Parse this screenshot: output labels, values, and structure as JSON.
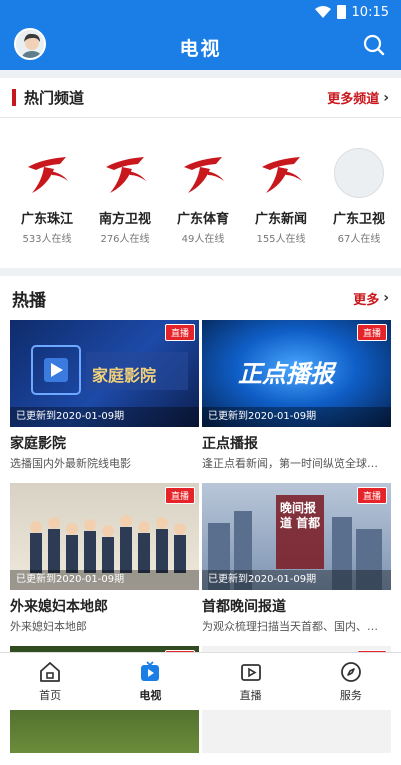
{
  "status": {
    "time": "10:15"
  },
  "header": {
    "title": "电视"
  },
  "hot_channels": {
    "title": "热门频道",
    "more": "更多频道",
    "items": [
      {
        "name": "广东珠江",
        "count": "533人在线"
      },
      {
        "name": "南方卫视",
        "count": "276人在线"
      },
      {
        "name": "广东体育",
        "count": "49人在线"
      },
      {
        "name": "广东新闻",
        "count": "155人在线"
      },
      {
        "name": "广东卫视",
        "count": "67人在线"
      }
    ]
  },
  "hot_play": {
    "title": "热播",
    "more": "更多",
    "badge": "直播",
    "items": [
      {
        "updated": "已更新到2020-01-09期",
        "title": "家庭影院",
        "desc": "选播国内外最新院线电影",
        "thumb_text": "家庭影院"
      },
      {
        "updated": "已更新到2020-01-09期",
        "title": "正点播报",
        "desc": "逢正点看新闻，第一时间纵览全球…",
        "thumb_text": "正点播报"
      },
      {
        "updated": "已更新到2020-01-09期",
        "title": "外来媳妇本地郎",
        "desc": "外来媳妇本地郎"
      },
      {
        "updated": "已更新到2020-01-09期",
        "title": "首都晚间报道",
        "desc": "为观众梳理扫描当天首都、国内、…",
        "thumb_text": "晚间报道 首都"
      }
    ]
  },
  "bottom_nav": [
    {
      "label": "首页"
    },
    {
      "label": "电视"
    },
    {
      "label": "直播"
    },
    {
      "label": "服务"
    }
  ],
  "colors": {
    "brand": "#1a7ee6",
    "accent": "#c8171d",
    "live": "#e5242a"
  }
}
